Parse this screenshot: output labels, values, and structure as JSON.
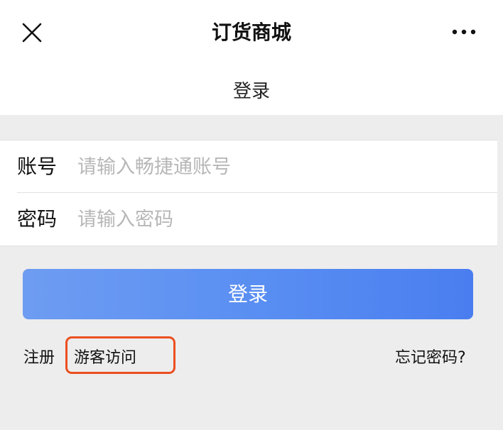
{
  "header": {
    "title": "订货商城",
    "close_icon": "close-icon",
    "more_icon": "more-horizontal-icon"
  },
  "subheader": {
    "title": "登录"
  },
  "form": {
    "account_label": "账号",
    "account_placeholder": "请输入畅捷通账号",
    "password_label": "密码",
    "password_placeholder": "请输入密码"
  },
  "actions": {
    "login_label": "登录",
    "register_label": "注册",
    "guest_label": "游客访问",
    "forgot_label": "忘记密码?"
  },
  "colors": {
    "login_gradient_start": "#6e9cf2",
    "login_gradient_end": "#4a7ef0",
    "highlight_border": "#ea4f20",
    "background": "#ededed"
  }
}
